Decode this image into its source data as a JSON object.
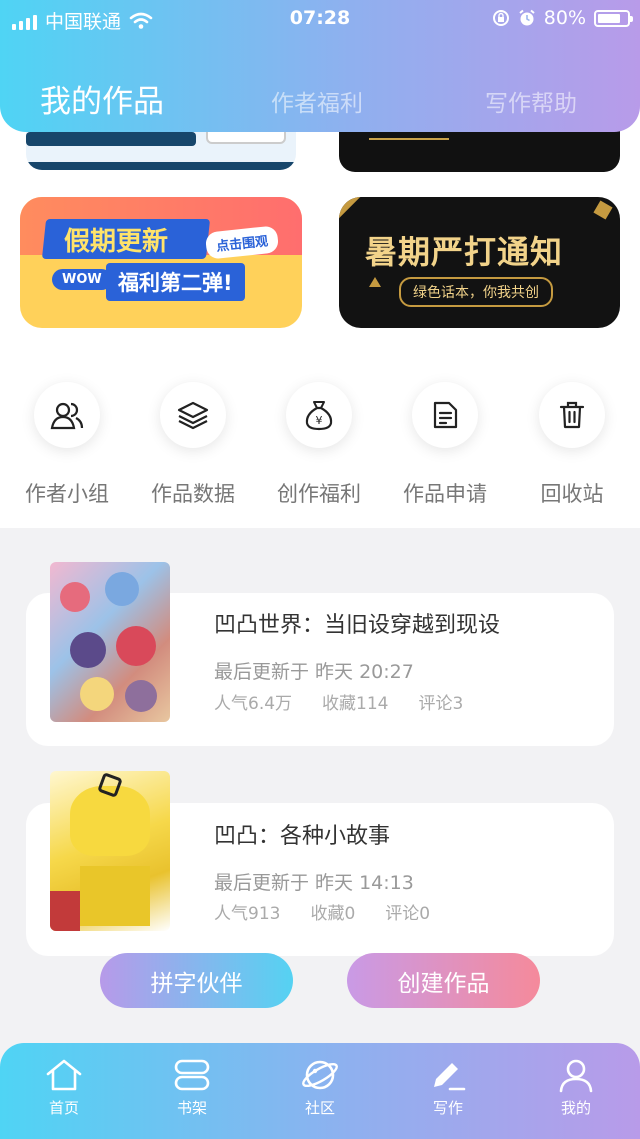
{
  "status_bar": {
    "carrier": "中国联通",
    "time": "07:28",
    "battery": "80%",
    "icons": [
      "signal-icon",
      "wifi-icon",
      "lock-rotation-icon",
      "alarm-icon",
      "battery-icon"
    ]
  },
  "header": {
    "tabs": [
      {
        "label": "我的作品",
        "active": true
      },
      {
        "label": "作者福利",
        "active": false
      },
      {
        "label": "写作帮助",
        "active": false
      }
    ]
  },
  "banners": [
    {
      "text": "假期更新",
      "subtext": "福利第二弹!",
      "badge": "点击围观",
      "tag": "WOW"
    },
    {
      "text": "暑期严打通知",
      "subtext": "绿色话本，你我共创"
    }
  ],
  "quick_actions": [
    {
      "label": "作者小组",
      "icon": "group-icon"
    },
    {
      "label": "作品数据",
      "icon": "layers-icon"
    },
    {
      "label": "创作福利",
      "icon": "money-bag-icon"
    },
    {
      "label": "作品申请",
      "icon": "document-icon"
    },
    {
      "label": "回收站",
      "icon": "trash-icon"
    }
  ],
  "works": [
    {
      "title": "凹凸世界：当旧设穿越到现设",
      "updated": "最后更新于 昨天 20:27",
      "popularity": "人气6.4万",
      "favorites": "收藏114",
      "comments": "评论3"
    },
    {
      "title": "凹凸：各种小故事",
      "updated": "最后更新于 昨天 14:13",
      "popularity": "人气913",
      "favorites": "收藏0",
      "comments": "评论0"
    }
  ],
  "actions": {
    "partner_label": "拼字伙伴",
    "create_label": "创建作品"
  },
  "bottom_nav": [
    {
      "label": "首页",
      "icon": "home-icon"
    },
    {
      "label": "书架",
      "icon": "bookshelf-icon"
    },
    {
      "label": "社区",
      "icon": "planet-icon"
    },
    {
      "label": "写作",
      "icon": "pen-icon"
    },
    {
      "label": "我的",
      "icon": "user-icon"
    }
  ],
  "colors": {
    "gradient_start": "#4fd4f4",
    "gradient_end": "#b89be9",
    "create_pill_end": "#f58a9b"
  }
}
